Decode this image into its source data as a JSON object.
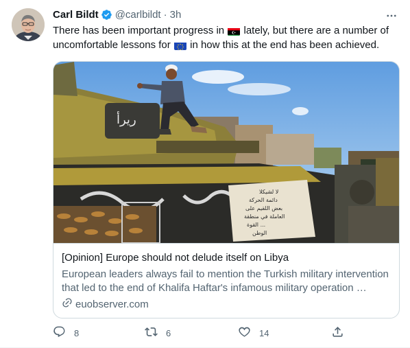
{
  "tweet": {
    "author_name": "Carl Bildt",
    "handle": "@carlbildt",
    "separator": "·",
    "time": "3h",
    "text_part1": "There has been important progress in",
    "text_part2": "lately, but there are a number of uncomfortable lessons for",
    "text_part3": "in how this at the end has been achieved.",
    "flag1_icon": "libya-flag-icon",
    "flag2_icon": "eu-flag-icon"
  },
  "card": {
    "title": "[Opinion] Europe should not delude itself on Libya",
    "description": "European leaders always fail to mention the Turkish military intervention that led to the end of Khalifa Haftar's infamous military operation …",
    "domain": "euobserver.com",
    "sign_text": "لا لشيكلا\nدائمة الحركة\nبعض اللقيم على\nالعاملة في منطقة\nالقوة ...\nالوطن"
  },
  "actions": {
    "reply_count": "8",
    "retweet_count": "6",
    "like_count": "14"
  },
  "colors": {
    "text": "#0f1419",
    "muted": "#536471",
    "verified": "#1d9bf0",
    "border": "#cfd9de"
  }
}
